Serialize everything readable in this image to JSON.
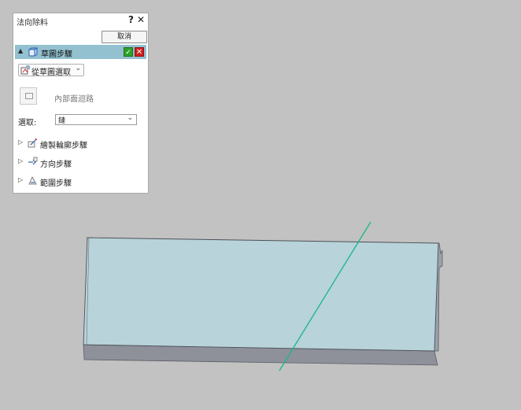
{
  "dialog": {
    "title": "法向除料",
    "help_label": "?",
    "close_label": "✕",
    "cancel_label": "取消",
    "active_step": {
      "expand_icon": "▲",
      "label": "草圖步驟",
      "icon": "sketch-step-icon",
      "ok_label": "✓",
      "cancel_label": "✕"
    },
    "from_sketch": {
      "label": "從草圖選取",
      "caret": "⌄",
      "icon": "sketch-select-icon"
    },
    "inner_loop": {
      "label": "內部面迴路",
      "icon": "inner-loop-icon"
    },
    "select": {
      "label": "選取:",
      "value": "鏈",
      "caret": "⌄"
    },
    "collapsed_steps": [
      {
        "expand_icon": "▷",
        "label": "繪製輪廓步驟",
        "icon": "draw-profile-icon"
      },
      {
        "expand_icon": "▷",
        "label": "方向步驟",
        "icon": "direction-step-icon"
      },
      {
        "expand_icon": "▷",
        "label": "範圍步驟",
        "icon": "extent-step-icon"
      }
    ]
  },
  "colors": {
    "background": "#c2c2c2",
    "step_header": "#93c1cf",
    "part_face": "#b8d3d9",
    "part_side": "#8e919a",
    "sketch_line": "#19b58a",
    "ok": "#2fa12a",
    "cancel": "#d21f1f"
  }
}
